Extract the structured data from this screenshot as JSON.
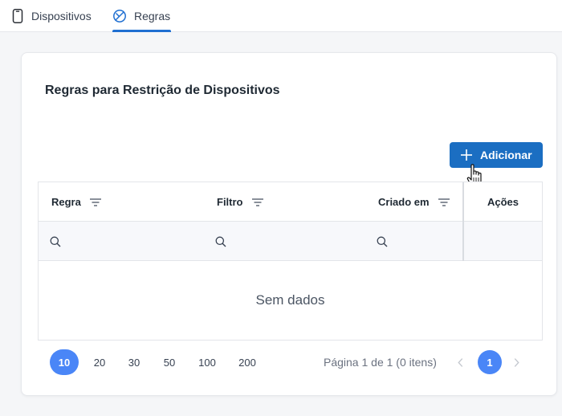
{
  "tabs": {
    "devices_label": "Dispositivos",
    "rules_label": "Regras",
    "active": "Regras",
    "accent_color": "#1f6fd1"
  },
  "card": {
    "title": "Regras para Restrição de Dispositivos",
    "add_button_label": "Adicionar",
    "add_button_color": "#1b6ec2"
  },
  "grid": {
    "columns": [
      {
        "label": "Regra"
      },
      {
        "label": "Filtro"
      },
      {
        "label": "Criado em"
      },
      {
        "label": "Ações"
      }
    ],
    "search_placeholders": [
      "",
      "",
      ""
    ],
    "empty_text": "Sem dados"
  },
  "pager": {
    "page_sizes": [
      "10",
      "20",
      "30",
      "50",
      "100",
      "200"
    ],
    "selected_size": "10",
    "info": "Página 1 de 1 (0 itens)",
    "current_page": "1",
    "accent_color": "#4a86f7"
  }
}
